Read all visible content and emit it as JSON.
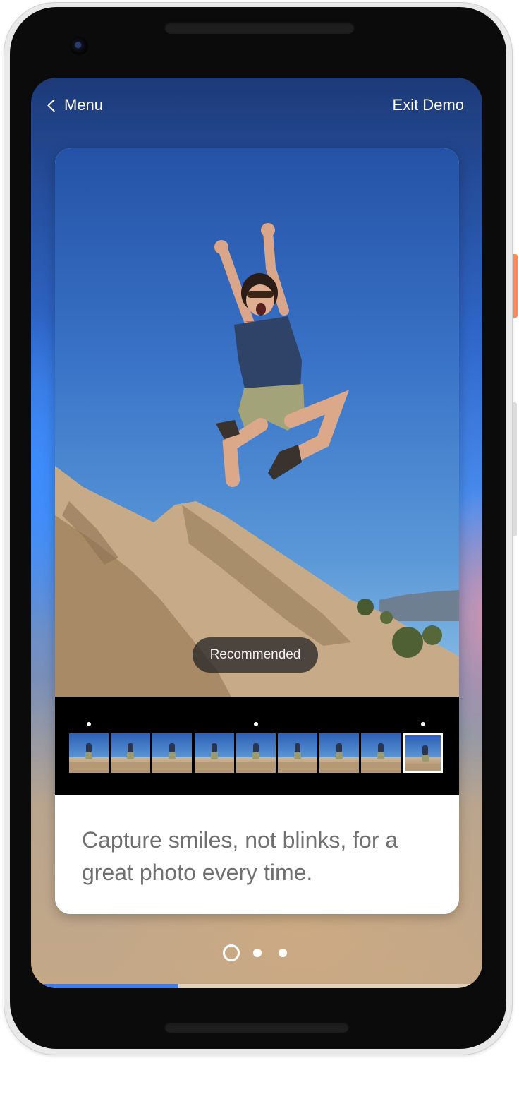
{
  "nav": {
    "back_label": "Menu",
    "exit_label": "Exit Demo"
  },
  "photo": {
    "badge_label": "Recommended"
  },
  "filmstrip": {
    "frame_count": 9,
    "selected_index": 8,
    "marked_indices": [
      0,
      4,
      8
    ]
  },
  "caption": {
    "text": "Capture smiles, not blinks, for a great photo every time."
  },
  "pagination": {
    "total": 3,
    "current": 1
  },
  "progress": {
    "fraction": 0.32
  },
  "colors": {
    "accent": "#3c7bf0",
    "caption_text": "#707070",
    "side_button": "#f28c5b"
  },
  "icons": {
    "back": "chevron-left-icon"
  }
}
